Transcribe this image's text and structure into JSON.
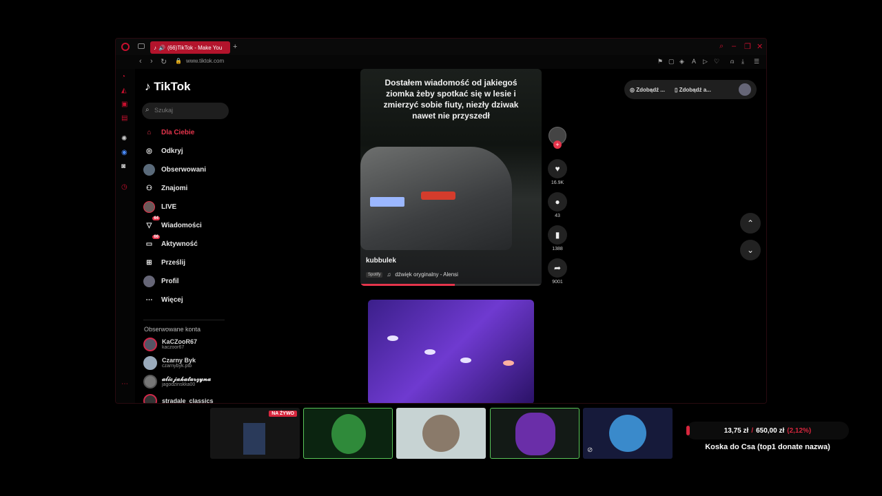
{
  "browser": {
    "tab_title": "(66)TikTok - Make You",
    "url": "www.tiktok.com"
  },
  "tiktok": {
    "logo": "TikTok",
    "search_placeholder": "Szukaj",
    "nav": [
      {
        "label": "Dla Ciebie",
        "icon": "home-icon"
      },
      {
        "label": "Odkryj",
        "icon": "compass-icon"
      },
      {
        "label": "Obserwowani",
        "icon": "following-avatar-icon"
      },
      {
        "label": "Znajomi",
        "icon": "friends-icon"
      },
      {
        "label": "LIVE",
        "icon": "live-icon"
      },
      {
        "label": "Wiadomości",
        "icon": "messages-icon",
        "badge": "64"
      },
      {
        "label": "Aktywność",
        "icon": "activity-icon",
        "badge": "66"
      },
      {
        "label": "Prześlij",
        "icon": "upload-icon"
      },
      {
        "label": "Profil",
        "icon": "profile-icon"
      },
      {
        "label": "Więcej",
        "icon": "more-icon"
      }
    ],
    "following_title": "Obserwowane konta",
    "accounts": [
      {
        "name": "KaCZooR67",
        "handle": "kaczoor67"
      },
      {
        "name": "Czarny Byk",
        "handle": "czarnybyk.ptb"
      },
      {
        "name": "𝓪𝓵𝓲𝓬𝓳𝓪𝓴𝓪𝓽𝓪𝓻𝔃𝔂𝓷𝓪",
        "handle": "jagodzinskka00"
      },
      {
        "name": "stradale_classics",
        "handle": ""
      }
    ],
    "video": {
      "caption": "Dostałem wiadomość od jakiegoś ziomka żeby spotkać się w lesie i zmierzyć sobie fiuty, niezły dziwak nawet nie przyszedł",
      "author": "kubbulek",
      "spotify": "Spotify",
      "music": "dźwięk oryginalny - Alensi",
      "progress": 0.52
    },
    "actions": {
      "likes": "16.9K",
      "comments": "43",
      "saves": "1388",
      "shares": "9001"
    },
    "top_right": {
      "btn1": "Zdobądź ...",
      "btn2": "Zdobądź a..."
    }
  },
  "overlay": {
    "live_tag": "NA ŻYWO",
    "donate_current": "13,75 zł",
    "donate_sep": "/",
    "donate_goal": "650,00 zł",
    "donate_pct": "(2,12%)",
    "donate_title": "Koska do Csa (top1 donate nazwa)"
  },
  "colors": {
    "accent": "#e5344b",
    "opera": "#c8102e"
  }
}
